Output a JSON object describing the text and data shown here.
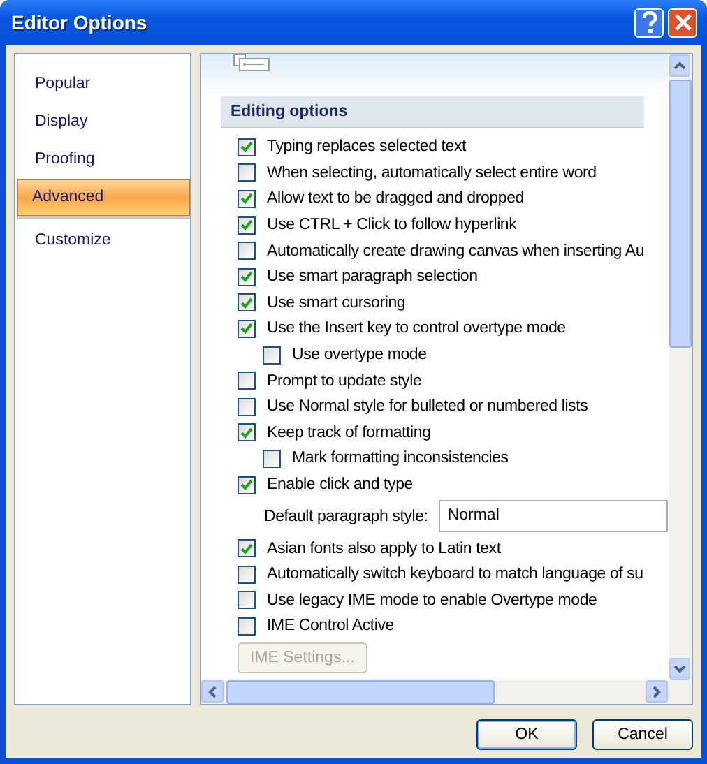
{
  "window": {
    "title": "Editor Options"
  },
  "sidebar": {
    "items": [
      {
        "label": "Popular",
        "selected": false
      },
      {
        "label": "Display",
        "selected": false
      },
      {
        "label": "Proofing",
        "selected": false
      },
      {
        "label": "Advanced",
        "selected": true
      },
      {
        "label": "Customize",
        "selected": false
      }
    ]
  },
  "section": {
    "title": "Editing options"
  },
  "options": [
    {
      "kind": "checkbox",
      "label": "Typing replaces selected text",
      "checked": true
    },
    {
      "kind": "checkbox",
      "label": "When selecting, automatically select entire word",
      "checked": false
    },
    {
      "kind": "checkbox",
      "label": "Allow text to be dragged and dropped",
      "checked": true
    },
    {
      "kind": "checkbox",
      "label": "Use CTRL + Click to follow hyperlink",
      "checked": true
    },
    {
      "kind": "checkbox",
      "label": "Automatically create drawing canvas when inserting Au",
      "checked": false
    },
    {
      "kind": "checkbox",
      "label": "Use smart paragraph selection",
      "checked": true
    },
    {
      "kind": "checkbox",
      "label": "Use smart cursoring",
      "checked": true
    },
    {
      "kind": "checkbox",
      "label": "Use the Insert key to control overtype mode",
      "checked": true,
      "children": [
        {
          "kind": "checkbox",
          "label": "Use overtype mode",
          "checked": false
        }
      ]
    },
    {
      "kind": "checkbox",
      "label": "Prompt to update style",
      "checked": false
    },
    {
      "kind": "checkbox",
      "label": "Use Normal style for bulleted or numbered lists",
      "checked": false
    },
    {
      "kind": "checkbox",
      "label": "Keep track of formatting",
      "checked": true,
      "children": [
        {
          "kind": "checkbox",
          "label": "Mark formatting inconsistencies",
          "checked": false
        }
      ]
    },
    {
      "kind": "checkbox",
      "label": "Enable click and type",
      "checked": true
    },
    {
      "kind": "field",
      "label": "Default paragraph style:",
      "value": "Normal"
    },
    {
      "kind": "checkbox",
      "label": "Asian fonts also apply to Latin text",
      "checked": true
    },
    {
      "kind": "checkbox",
      "label": "Automatically switch keyboard to match language of su",
      "checked": false
    },
    {
      "kind": "checkbox",
      "label": "Use legacy IME mode to enable Overtype mode",
      "checked": false
    },
    {
      "kind": "checkbox",
      "label": "IME Control Active",
      "checked": false
    },
    {
      "kind": "button",
      "label": "IME Settings...",
      "disabled": true
    }
  ],
  "buttons": [
    {
      "label": "OK"
    },
    {
      "label": "Cancel"
    }
  ]
}
